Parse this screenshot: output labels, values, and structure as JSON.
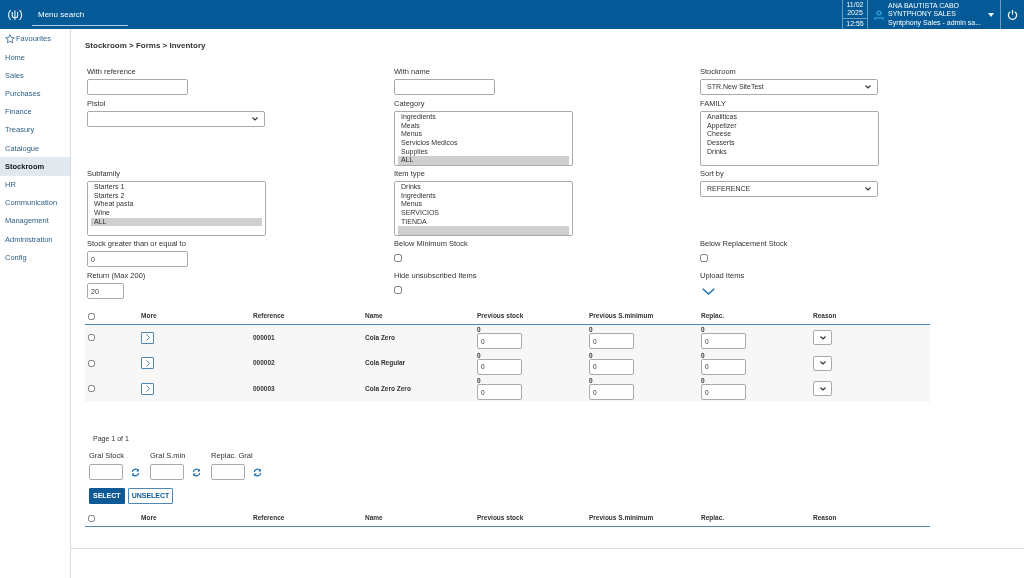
{
  "header": {
    "logo": "(ψ)",
    "menu_search": {
      "placeholder": "Menu search"
    },
    "date": "11/02",
    "year": "2025",
    "time": "12:55",
    "user": {
      "name": "ANA BAUTISTA CABO",
      "company": "SYNTPHONY SALES",
      "role": "Syntphony Sales - admin sa..."
    }
  },
  "sidebar": {
    "items": [
      {
        "label": "Favourites",
        "kind": "favourites",
        "selected": false
      },
      {
        "label": "Home",
        "kind": "link",
        "selected": false
      },
      {
        "label": "Sales",
        "kind": "link",
        "selected": false
      },
      {
        "label": "Purchases",
        "kind": "link",
        "selected": false
      },
      {
        "label": "Finance",
        "kind": "link",
        "selected": false
      },
      {
        "label": "Treasury",
        "kind": "link",
        "selected": false
      },
      {
        "label": "Catalogue",
        "kind": "link",
        "selected": false
      },
      {
        "label": "Stockroom",
        "kind": "link",
        "selected": true
      },
      {
        "label": "HR",
        "kind": "link",
        "selected": false
      },
      {
        "label": "Communication",
        "kind": "link",
        "selected": false
      },
      {
        "label": "Management",
        "kind": "link",
        "selected": false
      },
      {
        "label": "Administration",
        "kind": "link",
        "selected": false
      },
      {
        "label": "Config",
        "kind": "link",
        "selected": false
      }
    ]
  },
  "breadcrumb": "Stockroom > Forms > Inventory",
  "filters": [
    {
      "label": "With reference",
      "kind": "text"
    },
    {
      "label": "With name",
      "kind": "text"
    },
    {
      "label": "Stockroom",
      "kind": "select",
      "value": "STR.New SiteTest"
    },
    {
      "label": "Pistol",
      "kind": "select"
    },
    {
      "label": "Category",
      "kind": "listbox",
      "options": [
        {
          "label": "Ingredients",
          "selected": false
        },
        {
          "label": "Meals",
          "selected": false
        },
        {
          "label": "Menus",
          "selected": false
        },
        {
          "label": "Servicios Medicos",
          "selected": false
        },
        {
          "label": "Supplies",
          "selected": false
        },
        {
          "label": "ALL",
          "selected": true
        }
      ]
    },
    {
      "label": "FAMILY",
      "kind": "listbox",
      "options": [
        {
          "label": "Analiticas",
          "selected": false
        },
        {
          "label": "Appetizer",
          "selected": false
        },
        {
          "label": "Cheese",
          "selected": false
        },
        {
          "label": "Desserts",
          "selected": false
        },
        {
          "label": "Drinks",
          "selected": false
        }
      ]
    },
    {
      "label": "Subfamily",
      "kind": "listbox",
      "options": [
        {
          "label": "Starters 1",
          "selected": false
        },
        {
          "label": "Starters 2",
          "selected": false
        },
        {
          "label": "Wheat pasta",
          "selected": false
        },
        {
          "label": "Wine",
          "selected": false
        },
        {
          "label": "ALL",
          "selected": true
        }
      ]
    },
    {
      "label": "Item type",
      "kind": "listbox",
      "options": [
        {
          "label": "Drinks",
          "selected": false
        },
        {
          "label": "Ingredients",
          "selected": false
        },
        {
          "label": "Menus",
          "selected": false
        },
        {
          "label": "SERVICIOS",
          "selected": false
        },
        {
          "label": "TIENDA",
          "selected": false
        },
        {
          "selected": true
        }
      ]
    },
    {
      "label": "Sort by",
      "kind": "select",
      "value": "REFERENCE"
    },
    {
      "label": "Stock greater than or equal to",
      "kind": "text",
      "value": "0"
    },
    {
      "label": "Below Minimum Stock",
      "kind": "checkbox",
      "checked": false
    },
    {
      "label": "Below Replacement Stock",
      "kind": "checkbox",
      "checked": false
    },
    {
      "label": "Return (Max 200)",
      "kind": "short",
      "value": "20"
    },
    {
      "label": "Hide unsubscribed Items",
      "kind": "checkbox",
      "checked": false
    },
    {
      "label": "Upload Items",
      "kind": "tick"
    }
  ],
  "table": {
    "columns": [
      "More",
      "Reference",
      "Name",
      "Previous stock",
      "Previous S.minimum",
      "Replac.",
      "Reason"
    ],
    "header_checked": false,
    "rows": [
      {
        "checked": false,
        "reference": "000001",
        "name": "Cola Zero",
        "previous_stock": "0",
        "previous_stock_input": "0",
        "previous_minimum": "0",
        "previous_minimum_input": "0",
        "replac": "0",
        "replac_input": "0"
      },
      {
        "checked": false,
        "reference": "000002",
        "name": "Cola Regular",
        "previous_stock": "0",
        "previous_stock_input": "0",
        "previous_minimum": "0",
        "previous_minimum_input": "0",
        "replac": "0",
        "replac_input": "0"
      },
      {
        "checked": false,
        "reference": "000003",
        "name": "Cola Zero Zero",
        "previous_stock": "0",
        "previous_stock_input": "0",
        "previous_minimum": "0",
        "previous_minimum_input": "0",
        "replac": "0",
        "replac_input": "0"
      }
    ]
  },
  "pagination": "Page 1 of 1",
  "general_fields": [
    "Gral Stock",
    "Gral S.min",
    "Replac. Gral"
  ],
  "buttons": [
    {
      "label": "SELECT",
      "kind": "primary"
    },
    {
      "label": "UNSELECT",
      "kind": "outline"
    }
  ],
  "footer_table": {
    "columns": [
      "More",
      "Reference",
      "Name",
      "Previous stock",
      "Previous S.minimum",
      "Replac.",
      "Reason"
    ],
    "header_checked": false
  }
}
